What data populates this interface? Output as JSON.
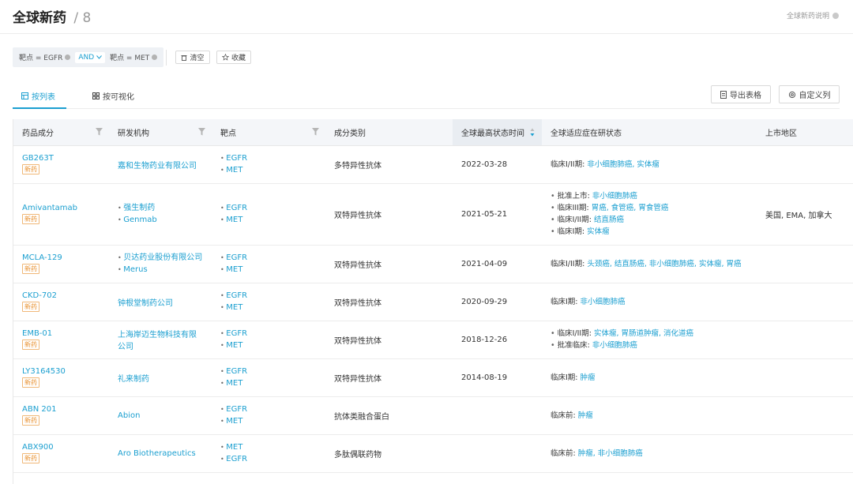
{
  "header": {
    "title": "全球新药",
    "separator": "/",
    "count": "8",
    "help": "全球新药说明"
  },
  "filters": {
    "chips": [
      "靶点 = EGFR",
      "靶点 = MET"
    ],
    "operator": "AND",
    "clear_label": "清空",
    "favorite_label": "收藏"
  },
  "tabs": [
    {
      "label": "按列表",
      "active": true
    },
    {
      "label": "按可视化",
      "active": false
    }
  ],
  "toolbar": {
    "export_label": "导出表格",
    "custom_label": "自定义列"
  },
  "table": {
    "columns": [
      "药品成分",
      "研发机构",
      "靶点",
      "成分类别",
      "全球最高状态时间",
      "全球适应症在研状态",
      "上市地区"
    ],
    "rows": [
      {
        "name": "GB263T",
        "badge": "新药",
        "orgs": [
          "嘉和生物药业有限公司"
        ],
        "targets": [
          "EGFR",
          "MET"
        ],
        "category": "多特异性抗体",
        "date": "2022-03-28",
        "status": [
          {
            "stage": "临床I/II期:",
            "text": "非小细胞肺癌, 实体瘤"
          }
        ],
        "region": ""
      },
      {
        "name": "Amivantamab",
        "badge": "新药",
        "orgs": [
          "强生制药",
          "Genmab"
        ],
        "targets": [
          "EGFR",
          "MET"
        ],
        "category": "双特异性抗体",
        "date": "2021-05-21",
        "status": [
          {
            "stage": "批准上市:",
            "text": "非小细胞肺癌"
          },
          {
            "stage": "临床III期:",
            "text": "胃癌, 食管癌, 胃食管癌"
          },
          {
            "stage": "临床I/II期:",
            "text": "结直肠癌"
          },
          {
            "stage": "临床I期:",
            "text": "实体瘤"
          }
        ],
        "region": "美国, EMA, 加拿大"
      },
      {
        "name": "MCLA-129",
        "badge": "新药",
        "orgs": [
          "贝达药业股份有限公司",
          "Merus"
        ],
        "targets": [
          "EGFR",
          "MET"
        ],
        "category": "双特异性抗体",
        "date": "2021-04-09",
        "status": [
          {
            "stage": "临床I/II期:",
            "text": "头颈癌, 结直肠癌, 非小细胞肺癌, 实体瘤, 胃癌"
          }
        ],
        "region": ""
      },
      {
        "name": "CKD-702",
        "badge": "新药",
        "orgs": [
          "钟根堂制药公司"
        ],
        "targets": [
          "EGFR",
          "MET"
        ],
        "category": "双特异性抗体",
        "date": "2020-09-29",
        "status": [
          {
            "stage": "临床I期:",
            "text": "非小细胞肺癌"
          }
        ],
        "region": ""
      },
      {
        "name": "EMB-01",
        "badge": "新药",
        "orgs": [
          "上海岸迈生物科技有限公司"
        ],
        "targets": [
          "EGFR",
          "MET"
        ],
        "category": "双特异性抗体",
        "date": "2018-12-26",
        "status": [
          {
            "stage": "临床I/II期:",
            "text": "实体瘤, 胃肠道肿瘤, 消化道癌"
          },
          {
            "stage": "批准临床:",
            "text": "非小细胞肺癌"
          }
        ],
        "region": ""
      },
      {
        "name": "LY3164530",
        "badge": "新药",
        "orgs": [
          "礼来制药"
        ],
        "targets": [
          "EGFR",
          "MET"
        ],
        "category": "双特异性抗体",
        "date": "2014-08-19",
        "status": [
          {
            "stage": "临床I期:",
            "text": "肿瘤"
          }
        ],
        "region": ""
      },
      {
        "name": "ABN 201",
        "badge": "新药",
        "orgs": [
          "Abion"
        ],
        "targets": [
          "EGFR",
          "MET"
        ],
        "category": "抗体类融合蛋白",
        "date": "",
        "status": [
          {
            "stage": "临床前:",
            "text": "肿瘤"
          }
        ],
        "region": ""
      },
      {
        "name": "ABX900",
        "badge": "新药",
        "orgs": [
          "Aro Biotherapeutics"
        ],
        "targets": [
          "MET",
          "EGFR"
        ],
        "category": "多肽偶联药物",
        "date": "",
        "status": [
          {
            "stage": "临床前:",
            "text": "肿瘤, 非小细胞肺癌"
          }
        ],
        "region": ""
      }
    ]
  }
}
